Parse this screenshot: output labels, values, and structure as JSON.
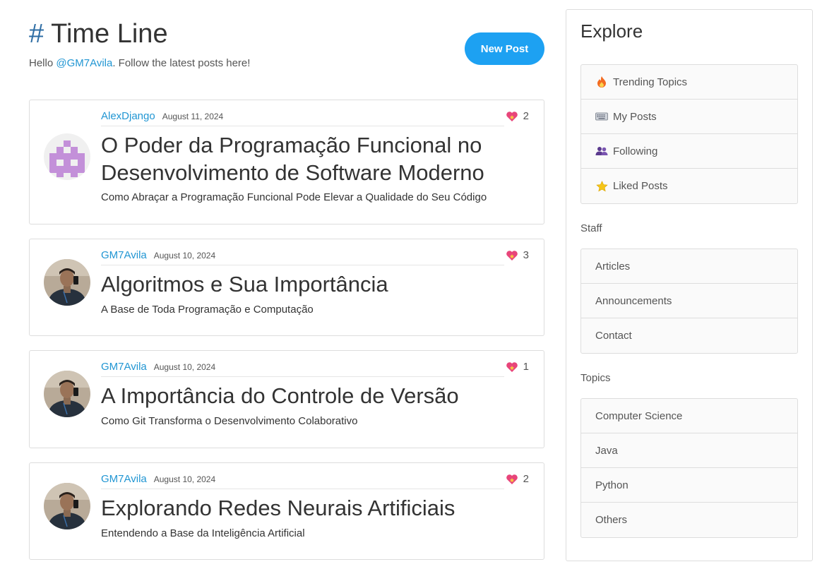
{
  "header": {
    "hash": "#",
    "title": "Time Line",
    "greeting_prefix": "Hello",
    "handle": "@GM7Avila",
    "greeting_suffix": ". Follow the latest posts here!",
    "new_post_label": "New Post"
  },
  "posts": [
    {
      "author": "AlexDjango",
      "date": "August 11, 2024",
      "likes": "2",
      "title": "O Poder da Programação Funcional no Desenvolvimento de Software Moderno",
      "subtitle": "Como Abraçar a Programação Funcional Pode Elevar a Qualidade do Seu Código",
      "avatar": "pixel-identicon"
    },
    {
      "author": "GM7Avila",
      "date": "August 10, 2024",
      "likes": "3",
      "title": "Algoritmos e Sua Importância",
      "subtitle": "A Base de Toda Programação e Computação",
      "avatar": "user-photo"
    },
    {
      "author": "GM7Avila",
      "date": "August 10, 2024",
      "likes": "1",
      "title": "A Importância do Controle de Versão",
      "subtitle": "Como Git Transforma o Desenvolvimento Colaborativo",
      "avatar": "user-photo"
    },
    {
      "author": "GM7Avila",
      "date": "August 10, 2024",
      "likes": "2",
      "title": "Explorando Redes Neurais Artificiais",
      "subtitle": "Entendendo a Base da Inteligência Artificial",
      "avatar": "user-photo"
    }
  ],
  "sidebar": {
    "title": "Explore",
    "explore_items": [
      {
        "label": "Trending Topics",
        "icon": "fire-icon"
      },
      {
        "label": "My Posts",
        "icon": "keyboard-icon"
      },
      {
        "label": "Following",
        "icon": "people-icon"
      },
      {
        "label": "Liked Posts",
        "icon": "star-icon"
      }
    ],
    "staff_label": "Staff",
    "staff_items": [
      "Articles",
      "Announcements",
      "Contact"
    ],
    "topics_label": "Topics",
    "topic_items": [
      "Computer Science",
      "Java",
      "Python",
      "Others"
    ]
  },
  "colors": {
    "accent": "#1da1f2",
    "link": "#2196d3",
    "heart": "#e8457a",
    "identicon": "#c390d9"
  }
}
